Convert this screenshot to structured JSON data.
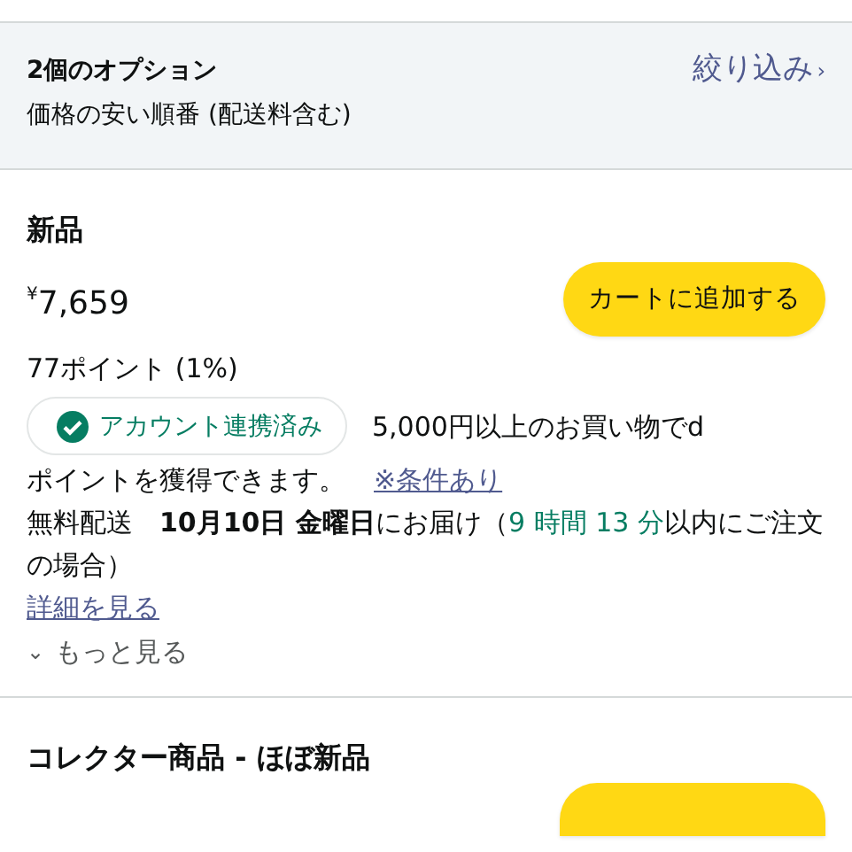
{
  "options_header": {
    "title": "2個のオプション",
    "sort": "価格の安い順番 (配送料含む)",
    "filter_link": "絞り込み",
    "filter_chevron": "›"
  },
  "offers": [
    {
      "condition": "新品",
      "price": "$^{¥}$7,659",
      "cart_button": "カートに追加する",
      "points": "77ポイント (1%)",
      "badge": {
        "label": "アカウント連携済み",
        "verified": true
      },
      "points_note": [
        "5,000円以上のお買い物でd",
        "ポイントを獲得できます。"
      ],
      "conditions_link": "※条件あり",
      "delivery": {
        "text": "無料配送　**10月10日 金曜日**にお届け（",
        "countdown": "9 時間 13 分",
        "after": "以内にご注文の場合）"
      },
      "details_link": "詳細を見る",
      "more": {
        "chevron": "⌄",
        "label": "もっと見る"
      }
    },
    {
      "condition": "コレクター商品 - ほぼ新品"
    }
  ]
}
